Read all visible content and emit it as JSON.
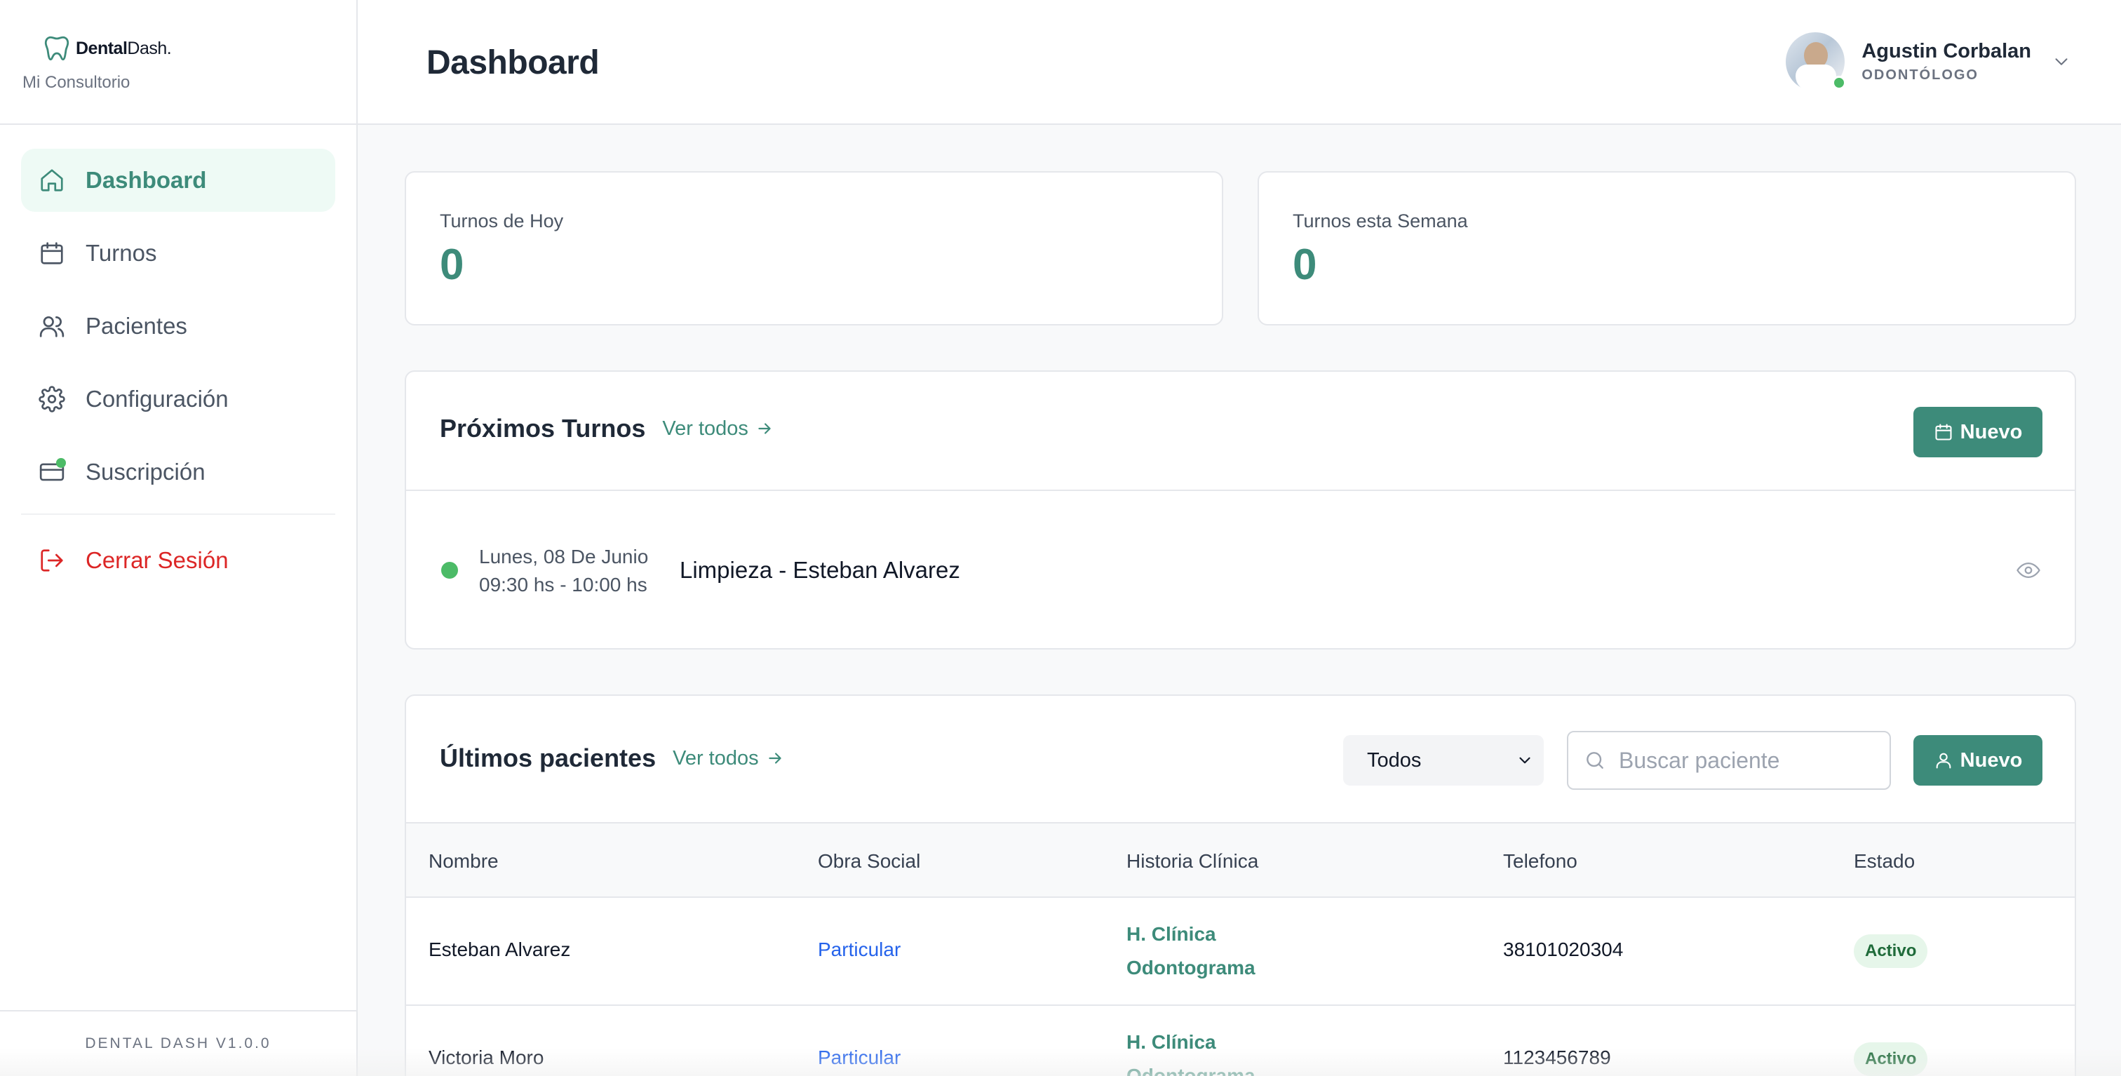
{
  "brand": {
    "name_bold": "Dental",
    "name_light": "Dash.",
    "subtitle": "Mi Consultorio"
  },
  "nav": {
    "items": [
      {
        "label": "Dashboard",
        "icon": "home-icon"
      },
      {
        "label": "Turnos",
        "icon": "calendar-icon"
      },
      {
        "label": "Pacientes",
        "icon": "users-icon"
      },
      {
        "label": "Configuración",
        "icon": "gear-icon"
      },
      {
        "label": "Suscripción",
        "icon": "credit-card-icon"
      }
    ],
    "logout": "Cerrar Sesión"
  },
  "footer": {
    "version": "DENTAL DASH V1.0.0"
  },
  "header": {
    "title": "Dashboard",
    "user_name": "Agustin Corbalan",
    "user_role": "ODONTÓLOGO"
  },
  "stats": [
    {
      "label": "Turnos de Hoy",
      "value": "0"
    },
    {
      "label": "Turnos esta Semana",
      "value": "0"
    }
  ],
  "appointments": {
    "title": "Próximos Turnos",
    "see_all": "Ver todos",
    "new_label": "Nuevo",
    "items": [
      {
        "date": "Lunes, 08 De Junio",
        "time": "09:30 hs - 10:00 hs",
        "description": "Limpieza - Esteban Alvarez",
        "status_color": "#4cbb67"
      }
    ]
  },
  "patients": {
    "title": "Últimos pacientes",
    "see_all": "Ver todos",
    "filter_value": "Todos",
    "search_placeholder": "Buscar paciente",
    "new_label": "Nuevo",
    "columns": [
      "Nombre",
      "Obra Social",
      "Historia Clínica",
      "Telefono",
      "Estado"
    ],
    "rows": [
      {
        "name": "Esteban Alvarez",
        "insurance": "Particular",
        "history": "H. Clínica",
        "odontogram": "Odontograma",
        "phone": "38101020304",
        "status": "Activo"
      },
      {
        "name": "Victoria Moro",
        "insurance": "Particular",
        "history": "H. Clínica",
        "odontogram": "Odontograma",
        "phone": "1123456789",
        "status": "Activo"
      }
    ]
  },
  "colors": {
    "accent": "#3d8b7a",
    "danger": "#dc2626",
    "online": "#4cbb67",
    "link": "#2563eb"
  }
}
